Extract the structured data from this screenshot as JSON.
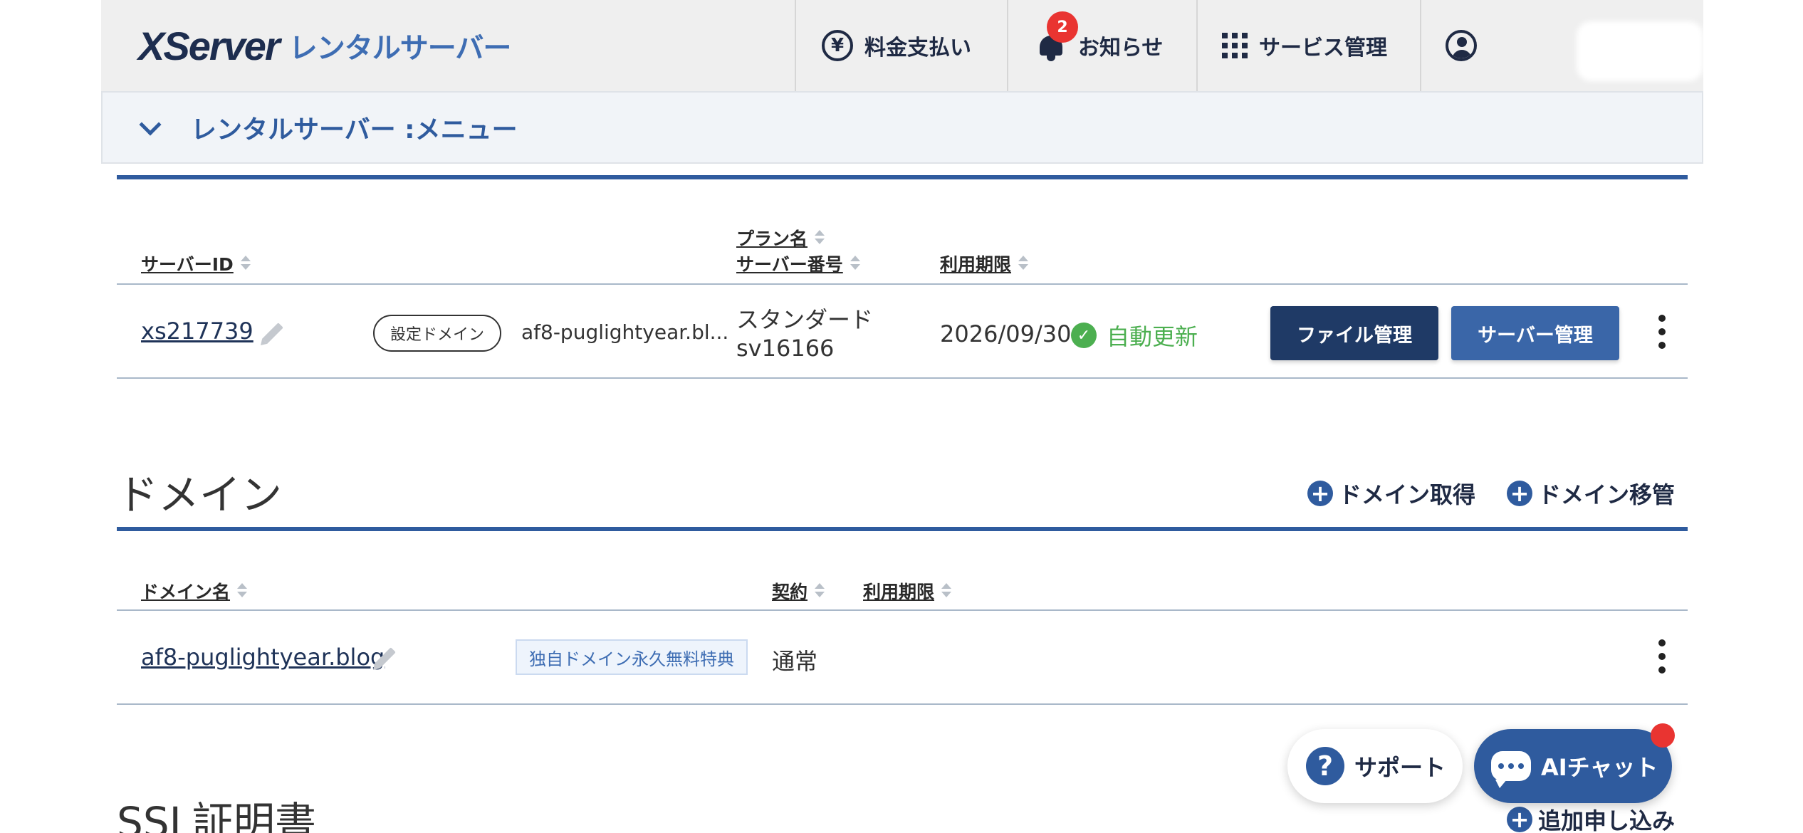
{
  "header": {
    "logo_main": "XServer",
    "logo_sub": "レンタルサーバー",
    "nav": {
      "payment": "料金支払い",
      "news": "お知らせ",
      "news_badge": "2",
      "service": "サービス管理"
    }
  },
  "menu": {
    "title": "レンタルサーバー :メニュー"
  },
  "server_table": {
    "headers": {
      "server_id": "サーバーID",
      "plan_name": "プラン名",
      "server_number": "サーバー番号",
      "expiry": "利用期限"
    },
    "row": {
      "server_id": "xs217739",
      "domain_pill": "設定ドメイン",
      "domain": "af8-puglightyear.bl...",
      "plan": "スタンダード",
      "server_no": "sv16166",
      "expiry": "2026/09/30",
      "auto_renew": "自動更新",
      "file_button": "ファイル管理",
      "server_button": "サーバー管理"
    }
  },
  "domain_section": {
    "title": "ドメイン",
    "acquire": "ドメイン取得",
    "transfer": "ドメイン移管",
    "headers": {
      "domain_name": "ドメイン名",
      "contract": "契約",
      "expiry": "利用期限"
    },
    "row": {
      "domain": "af8-puglightyear.blog",
      "tag": "独自ドメイン永久無料特典",
      "contract": "通常"
    }
  },
  "ssl_section": {
    "title": "SSL証明書",
    "add": "追加申し込み"
  },
  "floating": {
    "support": "サポート",
    "chat": "AIチャット"
  },
  "colors": {
    "brand_navy": "#1f2a44",
    "brand_blue": "#2f5b9e",
    "file_button": "#1f3a66",
    "server_button": "#3a66a8",
    "success": "#4caf50",
    "badge_red": "#e93431"
  }
}
